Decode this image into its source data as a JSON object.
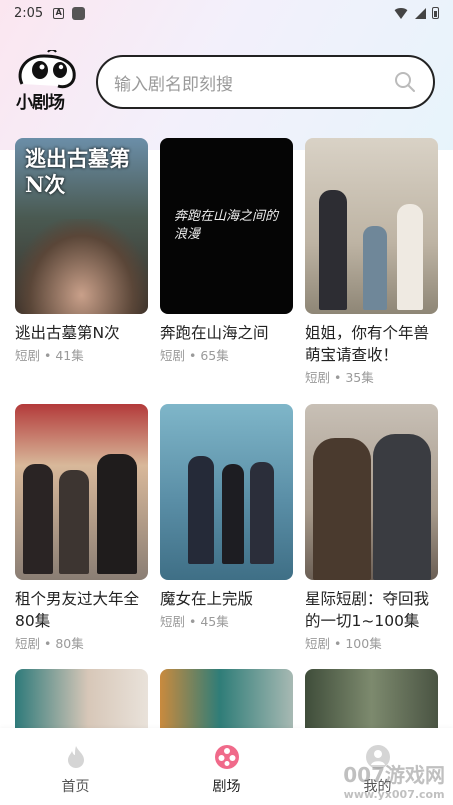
{
  "status_bar": {
    "time": "2:05"
  },
  "logo": {
    "text": "小剧场"
  },
  "search": {
    "placeholder": "输入剧名即刻搜"
  },
  "dramas": [
    {
      "title": "逃出古墓第N次",
      "type": "短剧",
      "episodes": "41集",
      "poster_text": "逃出古墓第N次"
    },
    {
      "title": "奔跑在山海之间",
      "type": "短剧",
      "episodes": "65集",
      "poster_text": "奔跑在山海之间的浪漫"
    },
    {
      "title": "姐姐，你有个年兽萌宝请查收！",
      "type": "短剧",
      "episodes": "35集",
      "poster_text": ""
    },
    {
      "title": "租个男友过大年全80集",
      "type": "短剧",
      "episodes": "80集",
      "poster_text": ""
    },
    {
      "title": "魔女在上完版",
      "type": "短剧",
      "episodes": "45集",
      "poster_text": ""
    },
    {
      "title": "星际短剧：夺回我的一切1~100集",
      "type": "短剧",
      "episodes": "100集",
      "poster_text": ""
    },
    {
      "title": "",
      "type": "",
      "episodes": "",
      "poster_text": ""
    },
    {
      "title": "",
      "type": "",
      "episodes": "",
      "poster_text": ""
    },
    {
      "title": "",
      "type": "",
      "episodes": "",
      "poster_text": ""
    }
  ],
  "meta_separator": " • ",
  "bottom_nav": [
    {
      "label": "首页",
      "icon": "flame-icon",
      "active": false
    },
    {
      "label": "剧场",
      "icon": "film-reel-icon",
      "active": true
    },
    {
      "label": "我的",
      "icon": "user-icon",
      "active": false
    }
  ],
  "watermark": {
    "main": "007游戏网",
    "sub": "www.yx007.com"
  },
  "colors": {
    "accent": "#f06a8a",
    "text": "#222222",
    "muted": "#9a9a9a"
  }
}
